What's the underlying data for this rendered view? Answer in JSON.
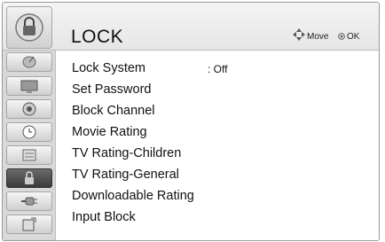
{
  "header": {
    "title": "LOCK",
    "icon": "lock-icon",
    "hints": {
      "move_label": "Move",
      "ok_label": "OK"
    }
  },
  "sidebar": {
    "items": [
      {
        "icon": "satellite-dish-icon",
        "active": false
      },
      {
        "icon": "picture-icon",
        "active": false
      },
      {
        "icon": "audio-speaker-icon",
        "active": false
      },
      {
        "icon": "clock-icon",
        "active": false
      },
      {
        "icon": "options-icon",
        "active": false
      },
      {
        "icon": "lock-icon",
        "active": true
      },
      {
        "icon": "input-connector-icon",
        "active": false
      },
      {
        "icon": "usb-media-icon",
        "active": false
      }
    ]
  },
  "menu": {
    "items": [
      {
        "label": "Lock System",
        "value": ": Off"
      },
      {
        "label": "Set Password",
        "value": ""
      },
      {
        "label": "Block Channel",
        "value": ""
      },
      {
        "label": "Movie Rating",
        "value": ""
      },
      {
        "label": "TV Rating-Children",
        "value": ""
      },
      {
        "label": "TV Rating-General",
        "value": ""
      },
      {
        "label": "Downloadable Rating",
        "value": ""
      },
      {
        "label": "Input Block",
        "value": ""
      }
    ]
  },
  "colors": {
    "active_tab": "#474747",
    "background": "#ffffff",
    "sidebar": "#d9d9d9"
  }
}
